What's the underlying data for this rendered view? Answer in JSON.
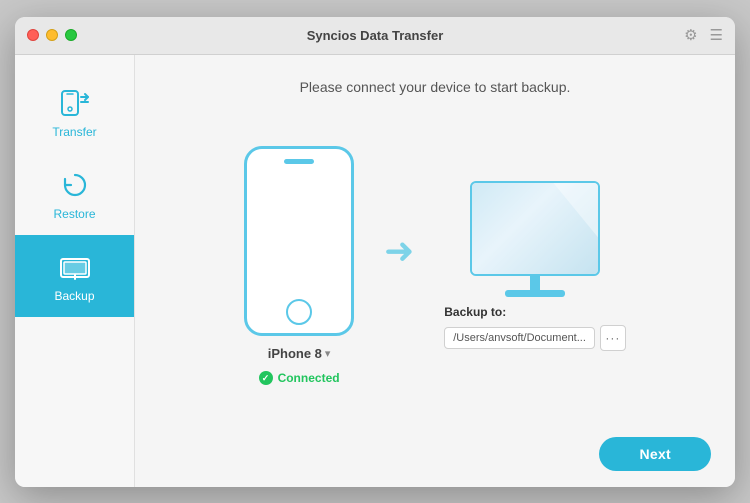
{
  "window": {
    "title": "Syncios Data Transfer",
    "traffic_lights": [
      "red",
      "yellow",
      "green"
    ]
  },
  "sidebar": {
    "items": [
      {
        "id": "transfer",
        "label": "Transfer",
        "active": false
      },
      {
        "id": "restore",
        "label": "Restore",
        "active": false
      },
      {
        "id": "backup",
        "label": "Backup",
        "active": true
      }
    ]
  },
  "content": {
    "header": "Please connect your device to start backup.",
    "device": {
      "name": "iPhone 8",
      "status": "Connected",
      "dropdown_visible": true
    },
    "backup": {
      "label": "Backup to:",
      "path": "/Users/anvsoft/Document...",
      "more_button": "···"
    },
    "next_button": "Next"
  }
}
